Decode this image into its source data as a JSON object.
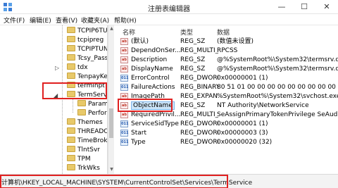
{
  "window": {
    "title": "注册表编辑器",
    "minimize_glyph": "—",
    "maximize_glyph": "☐",
    "close_glyph": "✕"
  },
  "menu": [
    "文件(F)",
    "编辑(E)",
    "查看(V)",
    "收藏夹(A)",
    "帮助(H)"
  ],
  "tree": {
    "items": [
      {
        "label": "TCPIP6TUNN"
      },
      {
        "label": "tcpipreg"
      },
      {
        "label": "TCPIPTUNN"
      },
      {
        "label": "Tcsy_Pass_II"
      },
      {
        "label": "tdx"
      },
      {
        "label": "TenpayKeyb"
      },
      {
        "label": "terminpt"
      },
      {
        "label": "TermService"
      },
      {
        "label": "Paramet"
      },
      {
        "label": "Perform"
      },
      {
        "label": "Themes"
      },
      {
        "label": "THREADORI"
      },
      {
        "label": "TimeBroker"
      },
      {
        "label": "TlntSvr"
      },
      {
        "label": "TPM"
      },
      {
        "label": "TrkWks"
      }
    ]
  },
  "list": {
    "columns": {
      "name": "名称",
      "type": "类型",
      "data": "数据"
    },
    "rows": [
      {
        "name": "(默认)",
        "type": "REG_SZ",
        "data": "(数值未设置)",
        "icon": "string-value-icon"
      },
      {
        "name": "DependOnSer...",
        "type": "REG_MULTI_...",
        "data": "RPCSS",
        "icon": "string-value-icon"
      },
      {
        "name": "Description",
        "type": "REG_SZ",
        "data": "@%SystemRoot%\\System32\\termsrv.dll,-26",
        "icon": "string-value-icon"
      },
      {
        "name": "DisplayName",
        "type": "REG_SZ",
        "data": "@%SystemRoot%\\System32\\termsrv.dll,-26",
        "icon": "string-value-icon"
      },
      {
        "name": "ErrorControl",
        "type": "REG_DWORD",
        "data": "0x00000001 (1)",
        "icon": "binary-value-icon"
      },
      {
        "name": "FailureActions",
        "type": "REG_BINARY",
        "data": "80 51 01 00 00 00 00 00 00 00 00 00 03 00",
        "icon": "binary-value-icon"
      },
      {
        "name": "ImagePath",
        "type": "REG_EXPAN...",
        "data": "%SystemRoot%\\System32\\svchost.exe -k N",
        "icon": "string-value-icon"
      },
      {
        "name": "ObjectName",
        "type": "REG_SZ",
        "data": "NT Authority\\NetworkService",
        "icon": "string-value-icon"
      },
      {
        "name": "RequiredPrivil...",
        "type": "REG_MULTI_...",
        "data": "SeAssignPrimaryTokenPrivilege SeAuditPriv",
        "icon": "string-value-icon"
      },
      {
        "name": "ServiceSidType",
        "type": "REG_DWORD",
        "data": "0x00000001 (1)",
        "icon": "binary-value-icon"
      },
      {
        "name": "Start",
        "type": "REG_DWORD",
        "data": "0x00000003 (3)",
        "icon": "binary-value-icon"
      },
      {
        "name": "Type",
        "type": "REG_DWORD",
        "data": "0x00000020 (32)",
        "icon": "binary-value-icon"
      }
    ]
  },
  "statusbar": {
    "path": "计算机\\HKEY_LOCAL_MACHINE\\SYSTEM\\CurrentControlSet\\Services\\TermService"
  },
  "icon_glyphs": {
    "string": "ab",
    "binary": "011"
  },
  "colors": {
    "highlight_box": "#e02020",
    "selection": "#cce4f7",
    "folder": "#e8c96a"
  }
}
